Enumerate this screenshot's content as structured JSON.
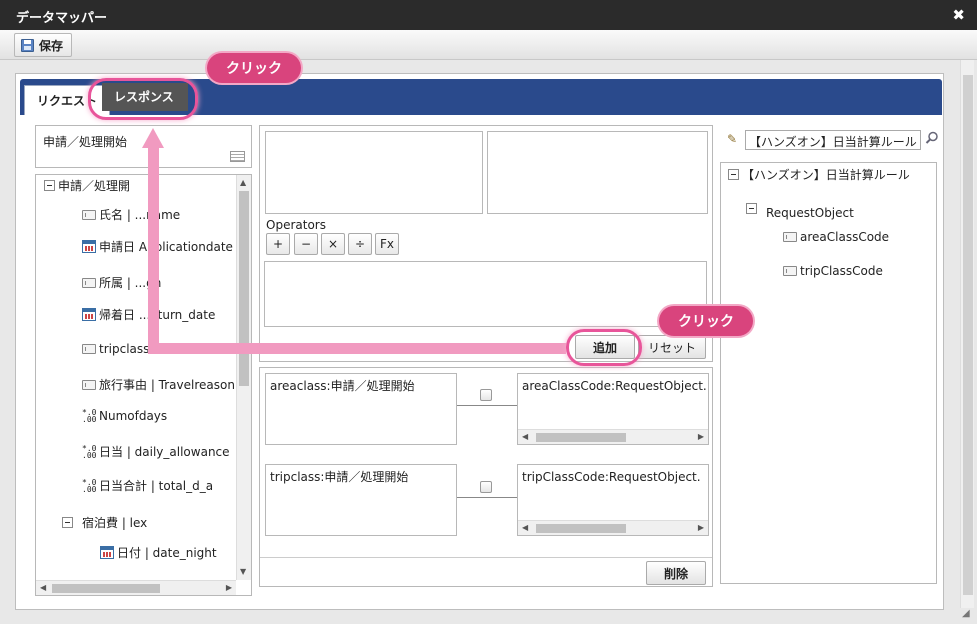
{
  "window": {
    "title": "データマッパー",
    "close_label": "✖"
  },
  "toolbar": {
    "save_label": "保存"
  },
  "tabs": [
    {
      "label": "リクエスト"
    },
    {
      "label": "レスポンス"
    }
  ],
  "callouts": {
    "tab": "クリック",
    "add": "クリック"
  },
  "left": {
    "source_title": "申請／処理開始",
    "tree": [
      {
        "label": "申請／処理開"
      },
      {
        "label": "氏名 | ...name"
      },
      {
        "label": "申請日 Applicationdate"
      },
      {
        "label": "所属 | ...gn"
      },
      {
        "label": "帰着日 ...eturn_date"
      },
      {
        "label": "tripclass"
      },
      {
        "label": "旅行事由 | Travelreason"
      },
      {
        "label": "Numofdays"
      },
      {
        "label": "日当 | daily_allowance"
      },
      {
        "label": "日当合計 | total_d_a"
      },
      {
        "label": "宿泊費 | lex"
      },
      {
        "label": "日付 | date_night"
      }
    ]
  },
  "middle": {
    "operators_label": "Operators",
    "operators": [
      "+",
      "−",
      "×",
      "÷",
      "Fx"
    ],
    "add_label": "追加",
    "reset_label": "リセット",
    "delete_label": "削除",
    "mappings": [
      {
        "source": "areaclass:申請／処理開始",
        "target": "areaClassCode:RequestObject.【ハ"
      },
      {
        "source": "tripclass:申請／処理開始",
        "target": "tripClassCode:RequestObject.【ハン"
      }
    ]
  },
  "right": {
    "search_value": "【ハンズオン】日当計算ルール",
    "tree": [
      {
        "label": "【ハンズオン】日当計算ルール"
      },
      {
        "label": "RequestObject"
      },
      {
        "label": "areaClassCode"
      },
      {
        "label": "tripClassCode"
      }
    ]
  }
}
